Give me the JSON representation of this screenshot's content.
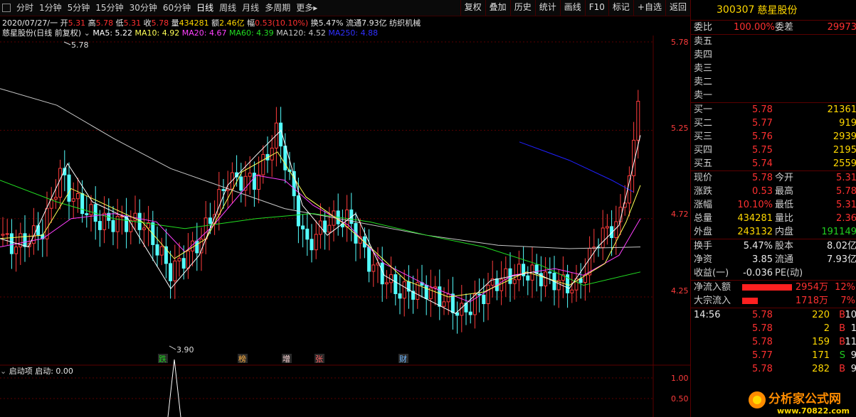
{
  "toolbar": {
    "tabs": [
      "分时",
      "1分钟",
      "5分钟",
      "15分钟",
      "30分钟",
      "60分钟",
      "日线",
      "周线",
      "月线",
      "多周期",
      "更多"
    ],
    "active_tab": "日线",
    "more_arrow": "▸",
    "right_buttons": [
      "复权",
      "叠加",
      "历史",
      "统计",
      "画线",
      "F10",
      "标记",
      "+自选",
      "返回"
    ]
  },
  "info": {
    "date": "2020/07/27/一",
    "open_label": "开",
    "open": "5.31",
    "high_label": "高",
    "high": "5.78",
    "low_label": "低",
    "low": "5.31",
    "close_label": "收",
    "close": "5.78",
    "vol_label": "量",
    "vol": "434281",
    "amt_label": "额",
    "amt": "2.46亿",
    "chg_label": "幅",
    "chg": "0.53(10.10%)",
    "turn_label": "换",
    "turn": "5.47%",
    "float_label": "流通",
    "float": "7.93亿",
    "industry": "纺织机械"
  },
  "ma": {
    "title": "慈星股份(日线 前复权)",
    "ma5": "MA5: 5.22",
    "ma10": "MA10: 4.92",
    "ma20": "MA20: 4.67",
    "ma60": "MA60: 4.39",
    "ma120": "MA120: 4.52",
    "ma250": "MA250: 4.88"
  },
  "chart_data": {
    "type": "candlestick",
    "price_ticks": [
      "5.78",
      "5.25",
      "4.72",
      "4.25"
    ],
    "high_marker": "5.78",
    "low_marker": "3.90",
    "event_tags": [
      "跌",
      "榜",
      "增",
      "张",
      "财"
    ],
    "sub_ticks": [
      "1.00",
      "0.50"
    ],
    "colors": {
      "up": "#ff3c3c",
      "down": "#54ffff",
      "ma5": "#ffffff",
      "ma10": "#ffff55",
      "ma20": "#ff40ff",
      "ma60": "#22dd22",
      "ma120": "#c8c8c8",
      "ma250": "#2020ff"
    }
  },
  "sub": {
    "title": "启动项",
    "value": "启动: 0.00"
  },
  "panel": {
    "code": "300307",
    "name": "慈星股份",
    "weibi_label": "委比",
    "weibi": "100.00%",
    "weicha_label": "委差",
    "weicha": "29973",
    "sells": [
      {
        "label": "卖五"
      },
      {
        "label": "卖四"
      },
      {
        "label": "卖三"
      },
      {
        "label": "卖二"
      },
      {
        "label": "卖一"
      }
    ],
    "buys": [
      {
        "label": "买一",
        "price": "5.78",
        "vol": "21361"
      },
      {
        "label": "买二",
        "price": "5.77",
        "vol": "919"
      },
      {
        "label": "买三",
        "price": "5.76",
        "vol": "2939"
      },
      {
        "label": "买四",
        "price": "5.75",
        "vol": "2195"
      },
      {
        "label": "买五",
        "price": "5.74",
        "vol": "2559"
      }
    ],
    "quote": [
      {
        "l1": "现价",
        "v1": "5.78",
        "l2": "今开",
        "v2": "5.31"
      },
      {
        "l1": "涨跌",
        "v1": "0.53",
        "l2": "最高",
        "v2": "5.78"
      },
      {
        "l1": "涨幅",
        "v1": "10.10%",
        "l2": "最低",
        "v2": "5.31"
      },
      {
        "l1": "总量",
        "v1": "434281",
        "l2": "量比",
        "v2": "2.36"
      },
      {
        "l1": "外盘",
        "v1": "243132",
        "l2": "内盘",
        "v2": "191149"
      }
    ],
    "fund": [
      {
        "l1": "换手",
        "v1": "5.47%",
        "l2": "股本",
        "v2": "8.02亿"
      },
      {
        "l1": "净资",
        "v1": "3.85",
        "l2": "流通",
        "v2": "7.93亿"
      },
      {
        "l1": "收益(一)",
        "v1": "-0.036",
        "l2": "PE(动)",
        "v2": ""
      }
    ],
    "flow": [
      {
        "label": "净流入额",
        "value": "2954万",
        "pct": "12%"
      },
      {
        "label": "大宗流入",
        "value": "1718万",
        "pct": "7%"
      }
    ],
    "ticks": [
      {
        "time": "14:56",
        "price": "5.78",
        "vol": "220",
        "side": "B",
        "n": "10"
      },
      {
        "time": "",
        "price": "5.78",
        "vol": "2",
        "side": "B",
        "n": "1"
      },
      {
        "time": "",
        "price": "5.78",
        "vol": "159",
        "side": "B",
        "n": "11"
      },
      {
        "time": "",
        "price": "5.77",
        "vol": "171",
        "side": "S",
        "n": "9"
      },
      {
        "time": "",
        "price": "5.78",
        "vol": "282",
        "side": "B",
        "n": "9"
      }
    ]
  },
  "watermark": {
    "title": "分析家公式网",
    "url": "www.70822.com"
  }
}
